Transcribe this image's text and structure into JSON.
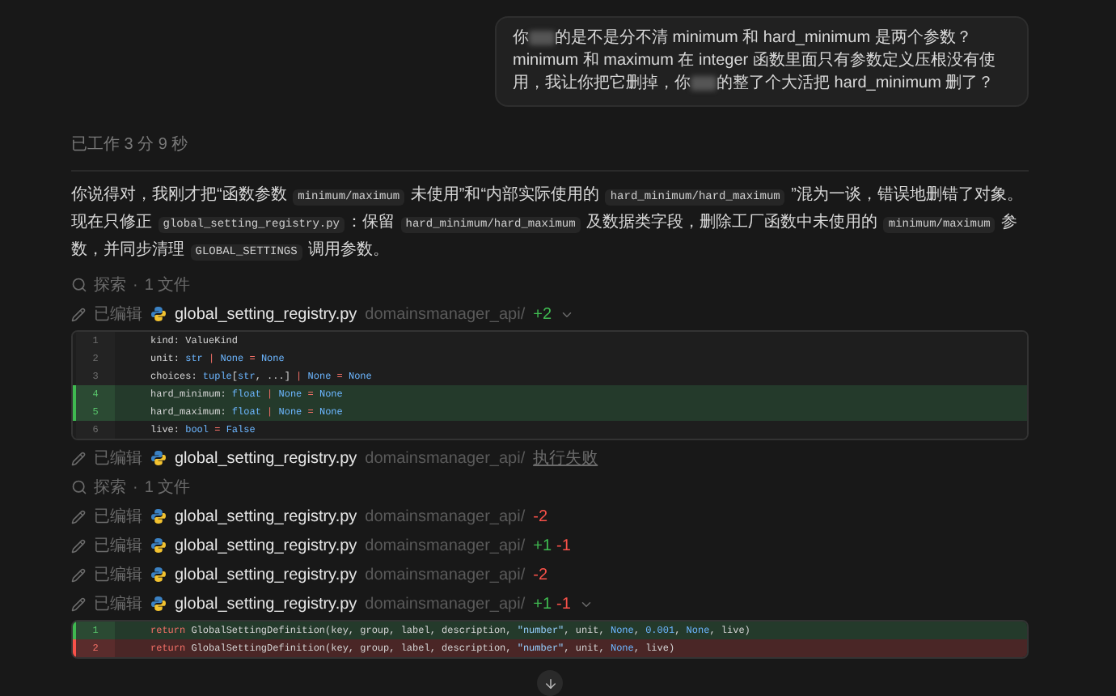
{
  "user_message": {
    "segments": [
      {
        "kind": "text",
        "text": "你"
      },
      {
        "kind": "redacted"
      },
      {
        "kind": "text",
        "text": "的是不是分不清 minimum 和 hard_minimum 是两个参数？minimum 和 maximum 在 integer 函数里面只有参数定义压根没有使用，我让你把它删掉，你"
      },
      {
        "kind": "redacted"
      },
      {
        "kind": "text",
        "text": "的整了个大活把 hard_minimum 删了？"
      }
    ]
  },
  "work_time": "已工作 3 分 9 秒",
  "reply": {
    "segments": [
      {
        "kind": "text",
        "text": "你说得对，我刚才把“函数参数 "
      },
      {
        "kind": "code",
        "text": "minimum/maximum"
      },
      {
        "kind": "text",
        "text": " 未使用”和“内部实际使用的 "
      },
      {
        "kind": "code",
        "text": "hard_minimum/hard_maximum"
      },
      {
        "kind": "text",
        "text": " ”混为一谈，错误地删错了对象。现在只修正 "
      },
      {
        "kind": "code",
        "text": "global_setting_registry.py"
      },
      {
        "kind": "text",
        "text": "：保留 "
      },
      {
        "kind": "code",
        "text": "hard_minimum/hard_maximum"
      },
      {
        "kind": "text",
        "text": " 及数据类字段，删除工厂函数中未使用的 "
      },
      {
        "kind": "code",
        "text": "minimum/maximum"
      },
      {
        "kind": "text",
        "text": " 参数，并同步清理 "
      },
      {
        "kind": "code",
        "text": "GLOBAL_SETTINGS"
      },
      {
        "kind": "text",
        "text": " 调用参数。"
      }
    ]
  },
  "activity": [
    {
      "kind": "search",
      "label": "探索",
      "separator": "·",
      "count": "1 文件"
    },
    {
      "kind": "edit",
      "action": "已编辑",
      "file": "global_setting_registry.py",
      "dir": "domainsmanager_api/",
      "added": "+2",
      "expanded": true,
      "code": [
        {
          "number": "1",
          "kind": "normal",
          "tokens": [
            {
              "kind": "plain",
              "text": "kind: ValueKind"
            }
          ]
        },
        {
          "number": "2",
          "kind": "normal",
          "tokens": [
            {
              "kind": "plain",
              "text": "unit: "
            },
            {
              "kind": "type",
              "text": "str"
            },
            {
              "kind": "op",
              "text": " | "
            },
            {
              "kind": "type",
              "text": "None"
            },
            {
              "kind": "op",
              "text": " = "
            },
            {
              "kind": "type",
              "text": "None"
            }
          ]
        },
        {
          "number": "3",
          "kind": "normal",
          "tokens": [
            {
              "kind": "plain",
              "text": "choices: "
            },
            {
              "kind": "type",
              "text": "tuple"
            },
            {
              "kind": "plain",
              "text": "["
            },
            {
              "kind": "type",
              "text": "str"
            },
            {
              "kind": "plain",
              "text": ", ...]"
            },
            {
              "kind": "op",
              "text": " | "
            },
            {
              "kind": "type",
              "text": "None"
            },
            {
              "kind": "op",
              "text": " = "
            },
            {
              "kind": "type",
              "text": "None"
            }
          ]
        },
        {
          "number": "4",
          "kind": "added",
          "tokens": [
            {
              "kind": "plain",
              "text": "hard_minimum: "
            },
            {
              "kind": "type",
              "text": "float"
            },
            {
              "kind": "op",
              "text": " | "
            },
            {
              "kind": "type",
              "text": "None"
            },
            {
              "kind": "op",
              "text": " = "
            },
            {
              "kind": "type",
              "text": "None"
            }
          ]
        },
        {
          "number": "5",
          "kind": "added",
          "tokens": [
            {
              "kind": "plain",
              "text": "hard_maximum: "
            },
            {
              "kind": "type",
              "text": "float"
            },
            {
              "kind": "op",
              "text": " | "
            },
            {
              "kind": "type",
              "text": "None"
            },
            {
              "kind": "op",
              "text": " = "
            },
            {
              "kind": "type",
              "text": "None"
            }
          ]
        },
        {
          "number": "6",
          "kind": "normal",
          "tokens": [
            {
              "kind": "plain",
              "text": "live: "
            },
            {
              "kind": "type",
              "text": "bool"
            },
            {
              "kind": "op",
              "text": " = "
            },
            {
              "kind": "type",
              "text": "False"
            }
          ]
        }
      ]
    },
    {
      "kind": "edit",
      "action": "已编辑",
      "file": "global_setting_registry.py",
      "dir": "domainsmanager_api/",
      "status": "执行失败",
      "expanded": false
    },
    {
      "kind": "search",
      "label": "探索",
      "separator": "·",
      "count": "1 文件"
    },
    {
      "kind": "edit",
      "action": "已编辑",
      "file": "global_setting_registry.py",
      "dir": "domainsmanager_api/",
      "removed": "-2",
      "expanded": false
    },
    {
      "kind": "edit",
      "action": "已编辑",
      "file": "global_setting_registry.py",
      "dir": "domainsmanager_api/",
      "added": "+1",
      "removed": "-1",
      "expanded": false
    },
    {
      "kind": "edit",
      "action": "已编辑",
      "file": "global_setting_registry.py",
      "dir": "domainsmanager_api/",
      "removed": "-2",
      "expanded": false
    },
    {
      "kind": "edit",
      "action": "已编辑",
      "file": "global_setting_registry.py",
      "dir": "domainsmanager_api/",
      "added": "+1",
      "removed": "-1",
      "expanded": true,
      "code": [
        {
          "number": "1",
          "kind": "added",
          "tokens": [
            {
              "kind": "keyword",
              "text": "return"
            },
            {
              "kind": "plain",
              "text": " GlobalSettingDefinition(key, group, label, description, "
            },
            {
              "kind": "string",
              "text": "\"number\""
            },
            {
              "kind": "plain",
              "text": ", unit, "
            },
            {
              "kind": "type",
              "text": "None"
            },
            {
              "kind": "plain",
              "text": ", "
            },
            {
              "kind": "number",
              "text": "0.001"
            },
            {
              "kind": "plain",
              "text": ", "
            },
            {
              "kind": "type",
              "text": "None"
            },
            {
              "kind": "plain",
              "text": ", live)"
            }
          ]
        },
        {
          "number": "2",
          "kind": "removed",
          "tokens": [
            {
              "kind": "keyword",
              "text": "return"
            },
            {
              "kind": "plain",
              "text": " GlobalSettingDefinition(key, group, label, description, "
            },
            {
              "kind": "string",
              "text": "\"number\""
            },
            {
              "kind": "plain",
              "text": ", unit, "
            },
            {
              "kind": "type",
              "text": "None"
            },
            {
              "kind": "plain",
              "text": ", live)"
            }
          ]
        }
      ]
    }
  ]
}
